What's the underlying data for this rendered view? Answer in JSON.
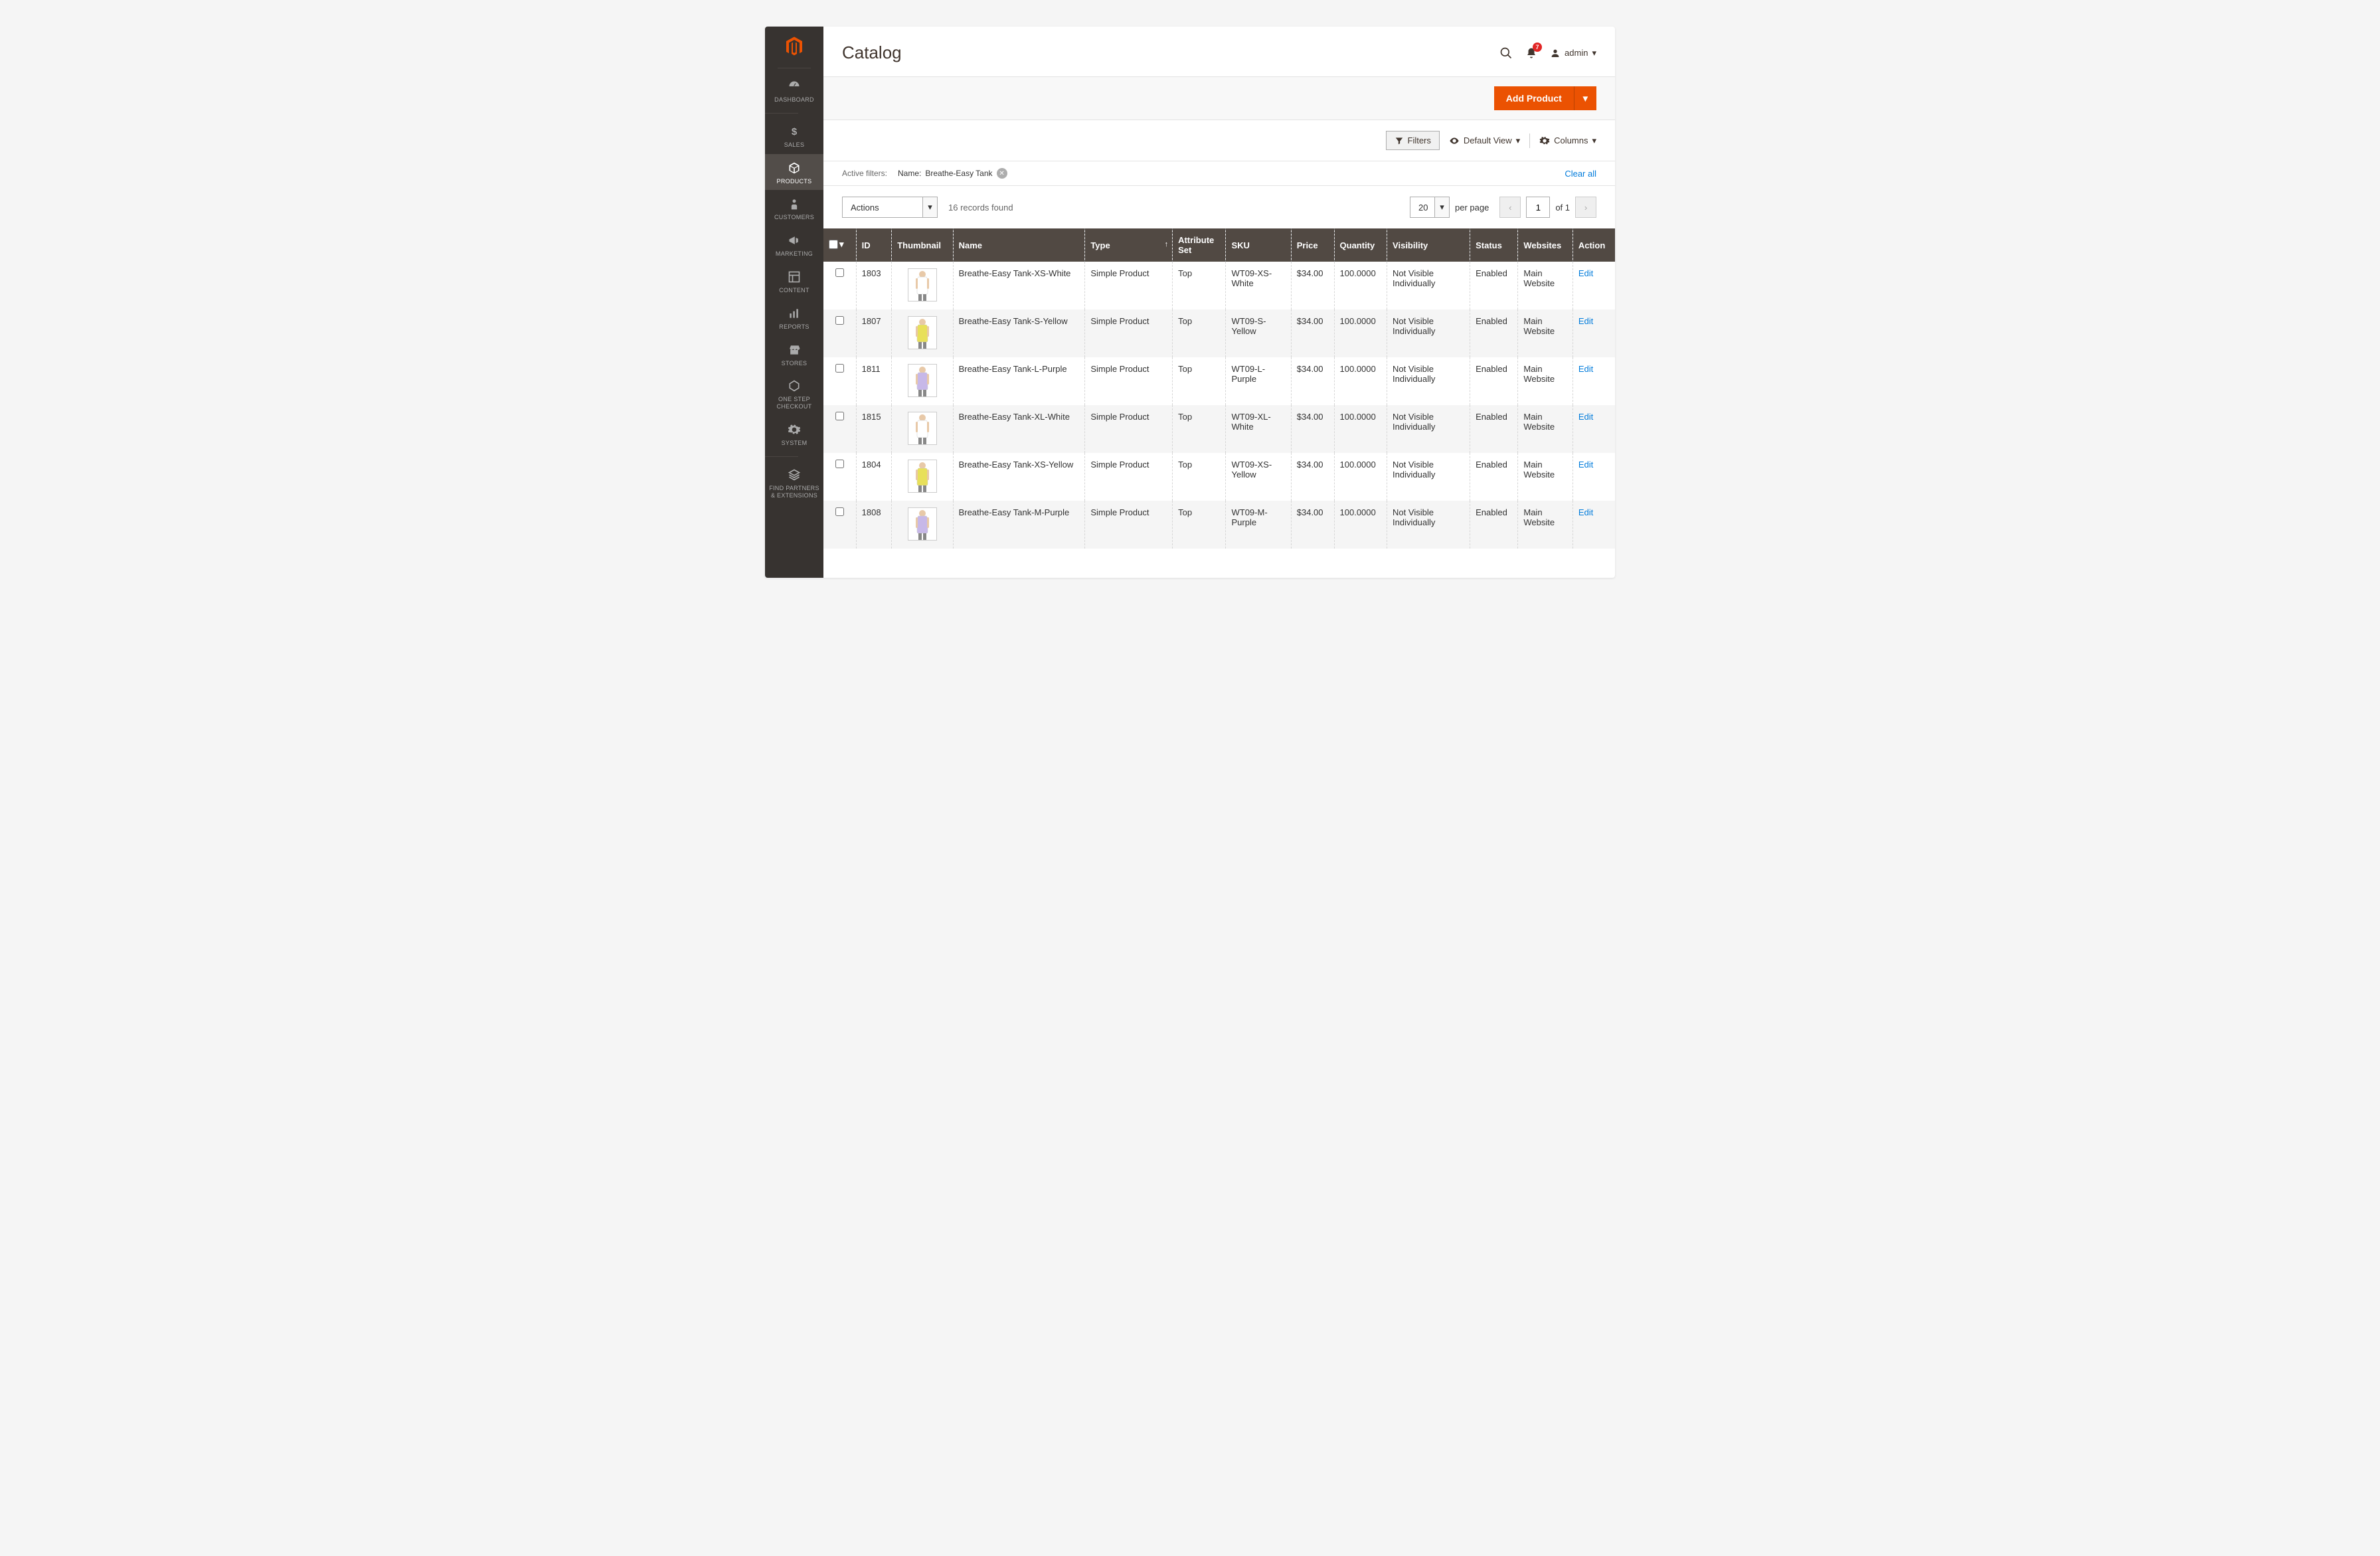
{
  "header": {
    "title": "Catalog",
    "notif_count": "7",
    "admin_label": "admin"
  },
  "sidebar": {
    "items": [
      {
        "label": "DASHBOARD",
        "icon": "dashboard"
      },
      {
        "label": "SALES",
        "icon": "dollar"
      },
      {
        "label": "PRODUCTS",
        "icon": "box",
        "active": true
      },
      {
        "label": "CUSTOMERS",
        "icon": "person"
      },
      {
        "label": "MARKETING",
        "icon": "megaphone"
      },
      {
        "label": "CONTENT",
        "icon": "layout"
      },
      {
        "label": "REPORTS",
        "icon": "chart"
      },
      {
        "label": "STORES",
        "icon": "store"
      },
      {
        "label": "ONE STEP CHECKOUT",
        "icon": "hex"
      },
      {
        "label": "SYSTEM",
        "icon": "gear"
      },
      {
        "label": "FIND PARTNERS & EXTENSIONS",
        "icon": "layers"
      }
    ]
  },
  "addbar": {
    "add_label": "Add Product"
  },
  "toolbar": {
    "filters": "Filters",
    "default_view": "Default View",
    "columns": "Columns"
  },
  "filters": {
    "label": "Active filters:",
    "chip_label": "Name:",
    "chip_value": "Breathe-Easy Tank",
    "clear": "Clear all"
  },
  "controls": {
    "actions": "Actions",
    "records": "16 records found",
    "per_page_value": "20",
    "per_page_label": "per page",
    "page": "1",
    "of": "of 1"
  },
  "columns": [
    "ID",
    "Thumbnail",
    "Name",
    "Type",
    "Attribute Set",
    "SKU",
    "Price",
    "Quantity",
    "Visibility",
    "Status",
    "Websites",
    "Action"
  ],
  "rows": [
    {
      "id": "1803",
      "name": "Breathe-Easy Tank-XS-White",
      "type": "Simple Product",
      "attr": "Top",
      "sku": "WT09-XS-White",
      "price": "$34.00",
      "qty": "100.0000",
      "vis": "Not Visible Individually",
      "status": "Enabled",
      "web": "Main Website",
      "action": "Edit",
      "color": "#ffffff"
    },
    {
      "id": "1807",
      "name": "Breathe-Easy Tank-S-Yellow",
      "type": "Simple Product",
      "attr": "Top",
      "sku": "WT09-S-Yellow",
      "price": "$34.00",
      "qty": "100.0000",
      "vis": "Not Visible Individually",
      "status": "Enabled",
      "web": "Main Website",
      "action": "Edit",
      "color": "#e8e05a"
    },
    {
      "id": "1811",
      "name": "Breathe-Easy Tank-L-Purple",
      "type": "Simple Product",
      "attr": "Top",
      "sku": "WT09-L-Purple",
      "price": "$34.00",
      "qty": "100.0000",
      "vis": "Not Visible Individually",
      "status": "Enabled",
      "web": "Main Website",
      "action": "Edit",
      "color": "#c7b8e8"
    },
    {
      "id": "1815",
      "name": "Breathe-Easy Tank-XL-White",
      "type": "Simple Product",
      "attr": "Top",
      "sku": "WT09-XL-White",
      "price": "$34.00",
      "qty": "100.0000",
      "vis": "Not Visible Individually",
      "status": "Enabled",
      "web": "Main Website",
      "action": "Edit",
      "color": "#ffffff"
    },
    {
      "id": "1804",
      "name": "Breathe-Easy Tank-XS-Yellow",
      "type": "Simple Product",
      "attr": "Top",
      "sku": "WT09-XS-Yellow",
      "price": "$34.00",
      "qty": "100.0000",
      "vis": "Not Visible Individually",
      "status": "Enabled",
      "web": "Main Website",
      "action": "Edit",
      "color": "#e8e05a"
    },
    {
      "id": "1808",
      "name": "Breathe-Easy Tank-M-Purple",
      "type": "Simple Product",
      "attr": "Top",
      "sku": "WT09-M-Purple",
      "price": "$34.00",
      "qty": "100.0000",
      "vis": "Not Visible Individually",
      "status": "Enabled",
      "web": "Main Website",
      "action": "Edit",
      "color": "#c7b8e8"
    }
  ]
}
